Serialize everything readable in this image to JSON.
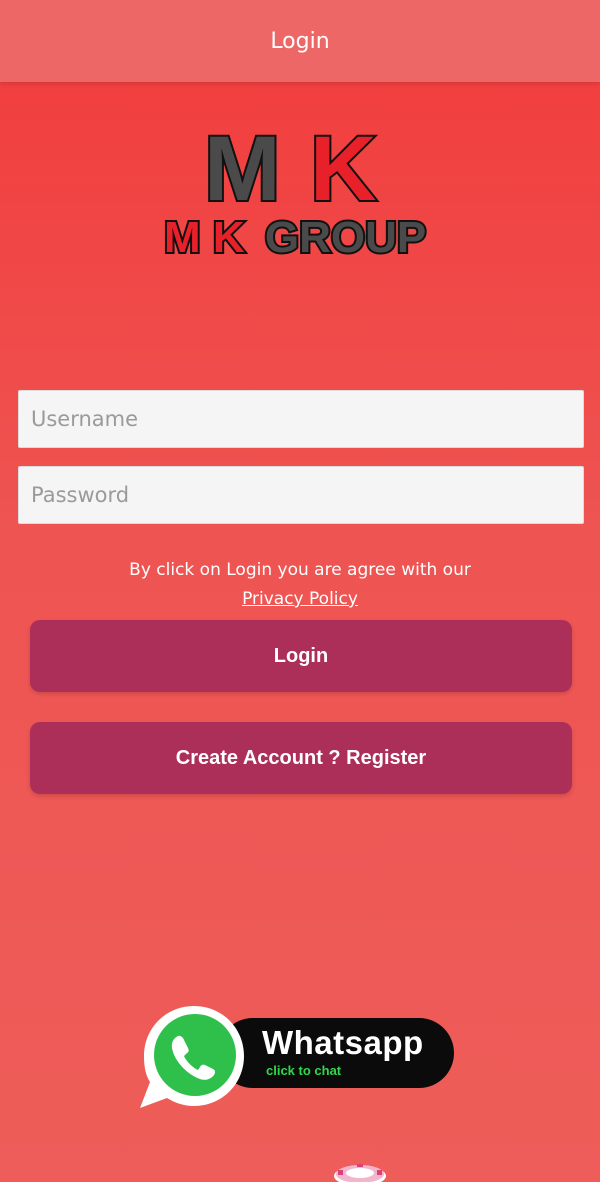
{
  "header": {
    "title": "Login"
  },
  "logo": {
    "mark": "MK",
    "m_letter": "M",
    "k_letter": "K",
    "wordmark": "M K GROUP",
    "wordmark_accent": "M K",
    "wordmark_rest": "GROUP",
    "icon": "mk-group-logo"
  },
  "form": {
    "username_placeholder": "Username",
    "username_value": "",
    "password_placeholder": "Password",
    "password_value": ""
  },
  "agreement": {
    "text": "By click on Login you are agree with our",
    "link": "Privacy Policy"
  },
  "buttons": {
    "login": "Login",
    "register": "Create Account ? Register"
  },
  "whatsapp": {
    "label": "Whatsapp",
    "sub": "click to chat",
    "icon": "whatsapp-icon"
  },
  "colors": {
    "header": "#ed6767",
    "background_top": "#f23b3b",
    "background_bottom": "#ee5d59",
    "button": "#ac2f5a",
    "logo_red": "#e8202a",
    "logo_dark": "#4a4a4a",
    "whatsapp_green": "#2fd84a"
  }
}
